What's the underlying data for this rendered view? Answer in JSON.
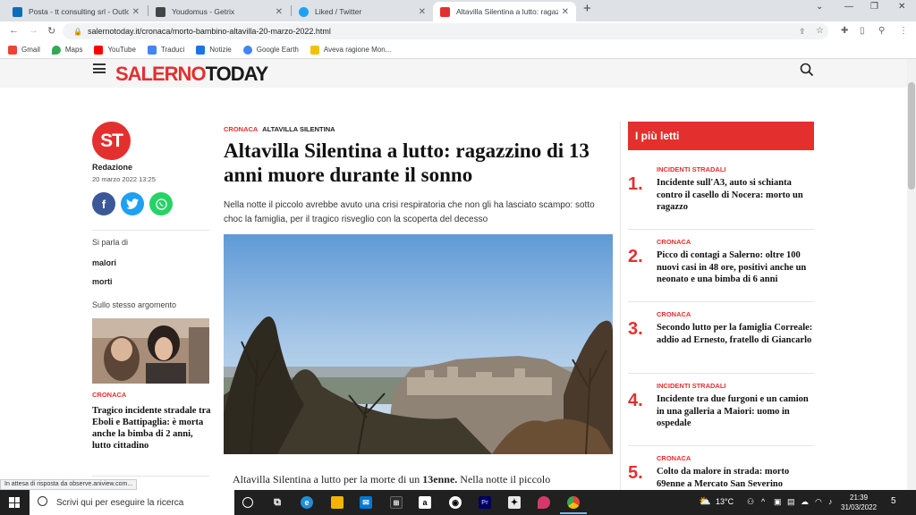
{
  "browser": {
    "tabs": [
      {
        "title": "Posta - tt consulting srl - Outlook",
        "color": "#0f6cbd"
      },
      {
        "title": "Youdomus - Getrix",
        "color": "#444444"
      },
      {
        "title": "Liked / Twitter",
        "color": "#1da1f2"
      },
      {
        "title": "Altavilla Silentina a lutto: ragazzino di 13 anni muore durante il sonno",
        "color": "#e3302f"
      }
    ],
    "url": "salernotoday.it/cronaca/morto-bambino-altavilla-20-marzo-2022.html",
    "bookmarks": [
      {
        "label": "Gmail",
        "color": "#ea4335"
      },
      {
        "label": "Maps",
        "color": "#34a853"
      },
      {
        "label": "YouTube",
        "color": "#ff0000"
      },
      {
        "label": "Traduci",
        "color": "#4285f4"
      },
      {
        "label": "Notizie",
        "color": "#1a73e8"
      },
      {
        "label": "Google Earth",
        "color": "#4285f4"
      },
      {
        "label": "Aveva ragione Mon...",
        "color": "#f2c200"
      }
    ]
  },
  "site": {
    "logo_part1": "SALERNO",
    "logo_part2": "TODAY",
    "accent": "#e3302f"
  },
  "article": {
    "category": "CRONACA",
    "location": "ALTAVILLA SILENTINA",
    "title": "Altavilla Silentina a lutto: ragazzino di 13 anni muore durante il sonno",
    "subtitle": "Nella notte il piccolo avrebbe avuto una crisi respiratoria che non gli ha lasciato scampo: sotto choc la famiglia, per il tragico risveglio con la scoperta del decesso",
    "body_start": "Altavilla Silentina a lutto per la morte di un",
    "body_bold": "13enne.",
    "body_end": "Nella notte il piccolo"
  },
  "author": {
    "initials": "ST",
    "name": "Redazione",
    "date": "20 marzo 2022 13:25"
  },
  "sidebar": {
    "topics_label": "Si parla di",
    "topics": [
      "malori",
      "morti"
    ],
    "related_label": "Sullo stesso argomento",
    "related_category": "CRONACA",
    "related_title": "Tragico incidente stradale tra Eboli e Battipaglia: è morta anche la bimba di 2 anni, lutto cittadino"
  },
  "most_read": {
    "heading": "I più letti",
    "items": [
      {
        "num": "1.",
        "category": "INCIDENTI STRADALI",
        "title": "Incidente sull'A3, auto si schianta contro il casello di Nocera: morto un ragazzo"
      },
      {
        "num": "2.",
        "category": "CRONACA",
        "title": "Picco di contagi a Salerno: oltre 100 nuovi casi in 48 ore, positivi anche un neonato e una bimba di 6 anni"
      },
      {
        "num": "3.",
        "category": "CRONACA",
        "title": "Secondo lutto per la famiglia Correale: addio ad Ernesto, fratello di Giancarlo"
      },
      {
        "num": "4.",
        "category": "INCIDENTI STRADALI",
        "title": "Incidente tra due furgoni e un camion in una galleria a Maiori: uomo in ospedale"
      },
      {
        "num": "5.",
        "category": "CRONACA",
        "title": "Colto da malore in strada: morto 69enne a Mercato San Severino"
      }
    ]
  },
  "status_bar": "In attesa di risposta da observe.aniview.com...",
  "taskbar": {
    "search_placeholder": "Scrivi qui per eseguire la ricerca",
    "temperature": "13°C",
    "time": "21:39",
    "date": "31/03/2022",
    "notifications": "5"
  }
}
